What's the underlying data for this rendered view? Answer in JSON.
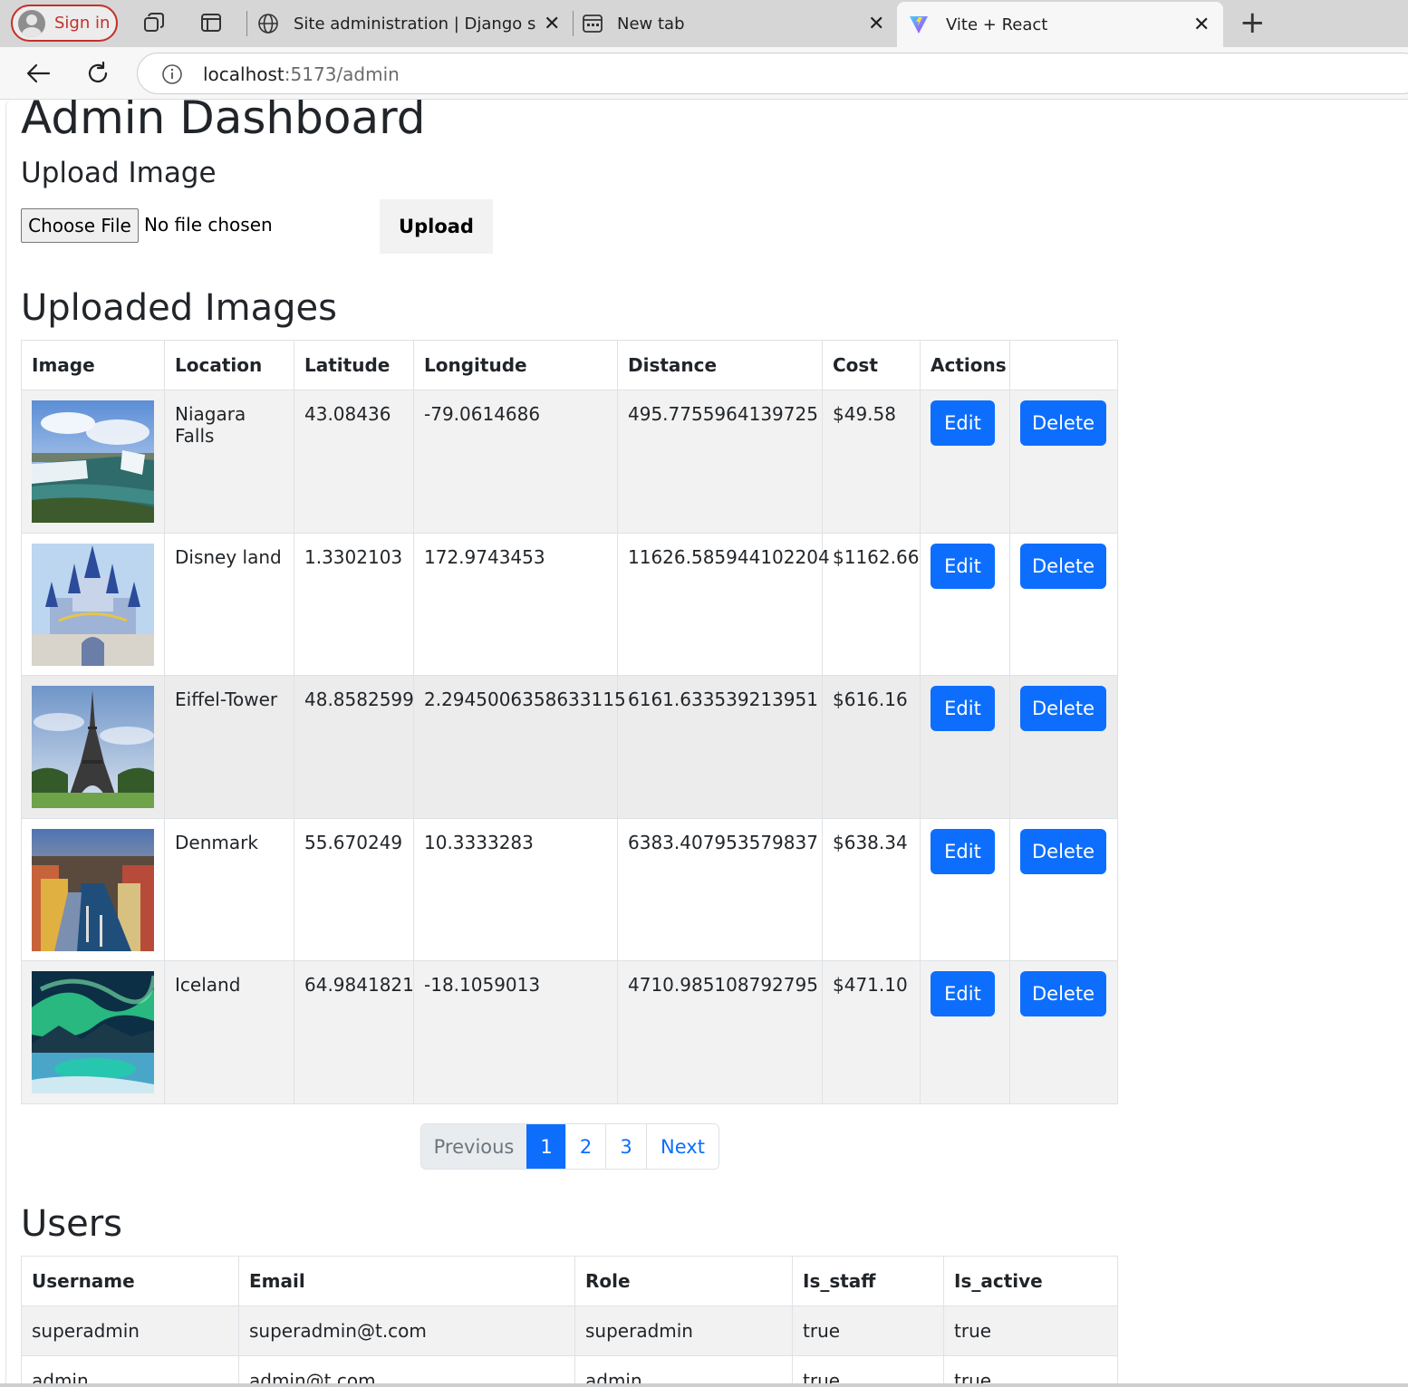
{
  "browser": {
    "signin_label": "Sign in",
    "tabs": [
      {
        "title": "Site administration | Django site a",
        "icon": "globe-icon"
      },
      {
        "title": "New tab",
        "icon": "new-tab-page-icon"
      },
      {
        "title": "Vite + React",
        "icon": "vite-logo-icon"
      }
    ],
    "url_host": "localhost",
    "url_path": ":5173/admin"
  },
  "page": {
    "title": "Admin Dashboard",
    "upload": {
      "heading": "Upload Image",
      "choose_file_label": "Choose File",
      "file_status": "No file chosen",
      "upload_button": "Upload"
    },
    "images_section": {
      "heading": "Uploaded Images",
      "columns": [
        "Image",
        "Location",
        "Latitude",
        "Longitude",
        "Distance",
        "Cost",
        "Actions"
      ],
      "edit_label": "Edit",
      "delete_label": "Delete",
      "rows": [
        {
          "image": "waterfall-photo",
          "location": "Niagara Falls",
          "latitude": "43.08436",
          "longitude": "-79.0614686",
          "distance": "495.7755964139725",
          "cost": "$49.58"
        },
        {
          "image": "castle-photo",
          "location": "Disney land",
          "latitude": "1.3302103",
          "longitude": "172.9743453",
          "distance": "11626.585944102204",
          "cost": "$1162.66"
        },
        {
          "image": "eiffel-tower-photo",
          "location": "Eiffel-Tower",
          "latitude": "48.8582599",
          "longitude": "2.2945006358633115",
          "distance": "6161.633539213951",
          "cost": "$616.16"
        },
        {
          "image": "harbor-town-photo",
          "location": "Denmark",
          "latitude": "55.670249",
          "longitude": "10.3333283",
          "distance": "6383.407953579837",
          "cost": "$638.34"
        },
        {
          "image": "aurora-photo",
          "location": "Iceland",
          "latitude": "64.9841821",
          "longitude": "-18.1059013",
          "distance": "4710.985108792795",
          "cost": "$471.10"
        }
      ]
    },
    "pagination": {
      "previous": "Previous",
      "pages": [
        "1",
        "2",
        "3"
      ],
      "active_page": "1",
      "next": "Next"
    },
    "users_section": {
      "heading": "Users",
      "columns": [
        "Username",
        "Email",
        "Role",
        "Is_staff",
        "Is_active"
      ],
      "rows": [
        {
          "username": "superadmin",
          "email": "superadmin@t.com",
          "role": "superadmin",
          "is_staff": "true",
          "is_active": "true"
        },
        {
          "username": "admin",
          "email": "admin@t.com",
          "role": "admin",
          "is_staff": "true",
          "is_active": "true"
        }
      ]
    }
  },
  "colors": {
    "primary": "#0d6efd",
    "signin_accent": "#c4302b",
    "row_stripe": "#f2f2f2"
  }
}
